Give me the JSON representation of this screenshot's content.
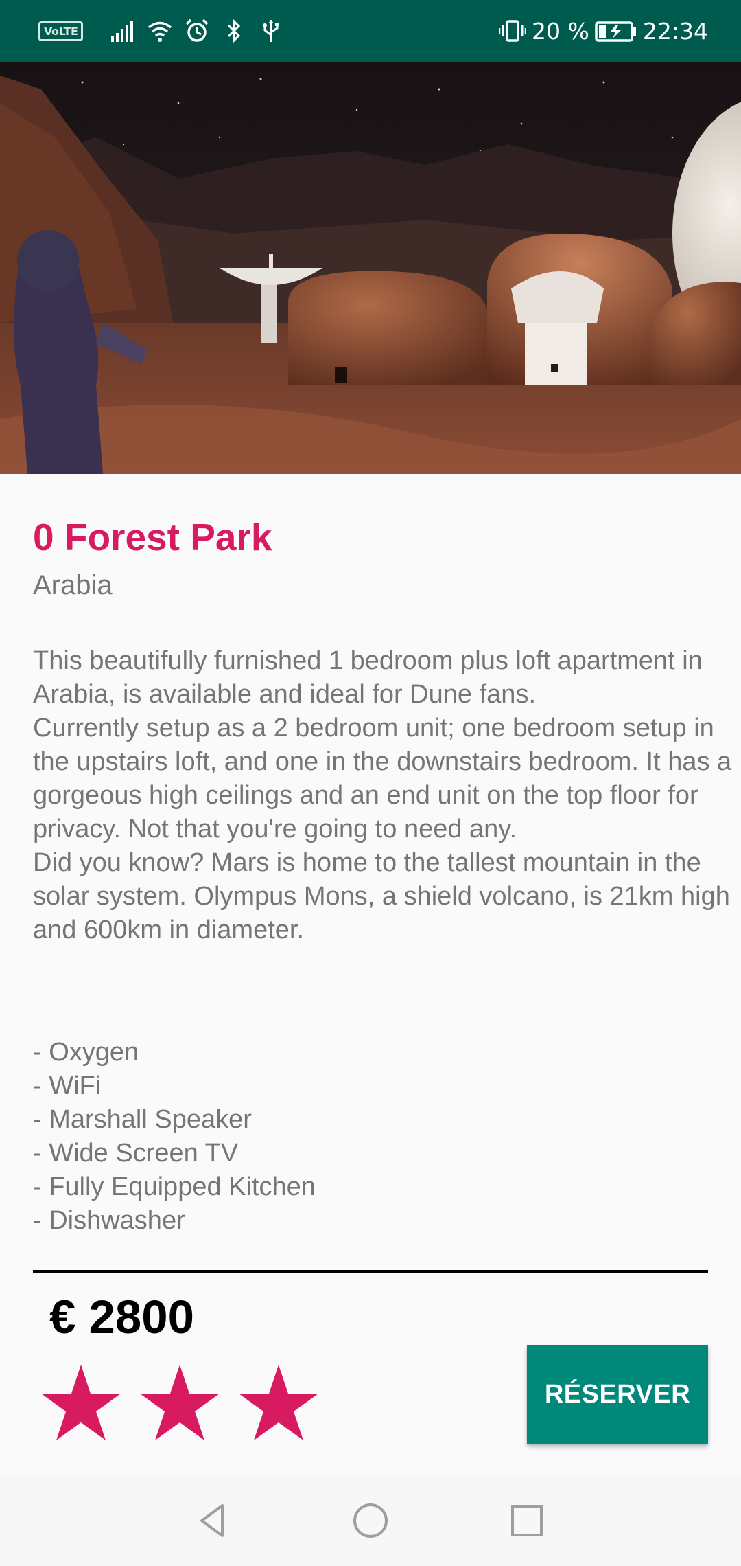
{
  "status_bar": {
    "network_badge": "VoLTE",
    "battery_percent": "20 %",
    "time": "22:34",
    "icons": [
      "signal-icon",
      "wifi-icon",
      "alarm-icon",
      "bluetooth-icon",
      "usb-icon",
      "vibrate-icon",
      "battery-charging-icon"
    ],
    "background_color": "#005b4f"
  },
  "listing": {
    "image_description_icon": "mars-habitat-image",
    "title": "0 Forest Park",
    "location": "Arabia",
    "description": [
      "This beautifully furnished 1 bedroom plus loft apartment in Arabia, is available and ideal for Dune fans.",
      "Currently setup as a 2 bedroom unit; one bedroom setup in the upstairs loft, and one in the downstairs bedroom. It has a gorgeous high ceilings and an end unit on the top floor for privacy. Not that you're going to need any.",
      "Did you know? Mars is home to the tallest mountain in the solar system. Olympus Mons, a shield volcano, is 21km high and 600km in diameter."
    ],
    "amenities": [
      "- Oxygen",
      "- WiFi",
      "- Marshall Speaker",
      "- Wide Screen TV",
      "- Fully Equipped Kitchen",
      "- Dishwasher"
    ],
    "price": "€ 2800",
    "rating": 3,
    "rating_max": 3,
    "reserve_label": "RÉSERVER",
    "accent_color": "#d81b60",
    "button_color": "#00897b"
  },
  "nav_bar": {
    "buttons": [
      "back-icon",
      "home-icon",
      "recents-icon"
    ]
  }
}
